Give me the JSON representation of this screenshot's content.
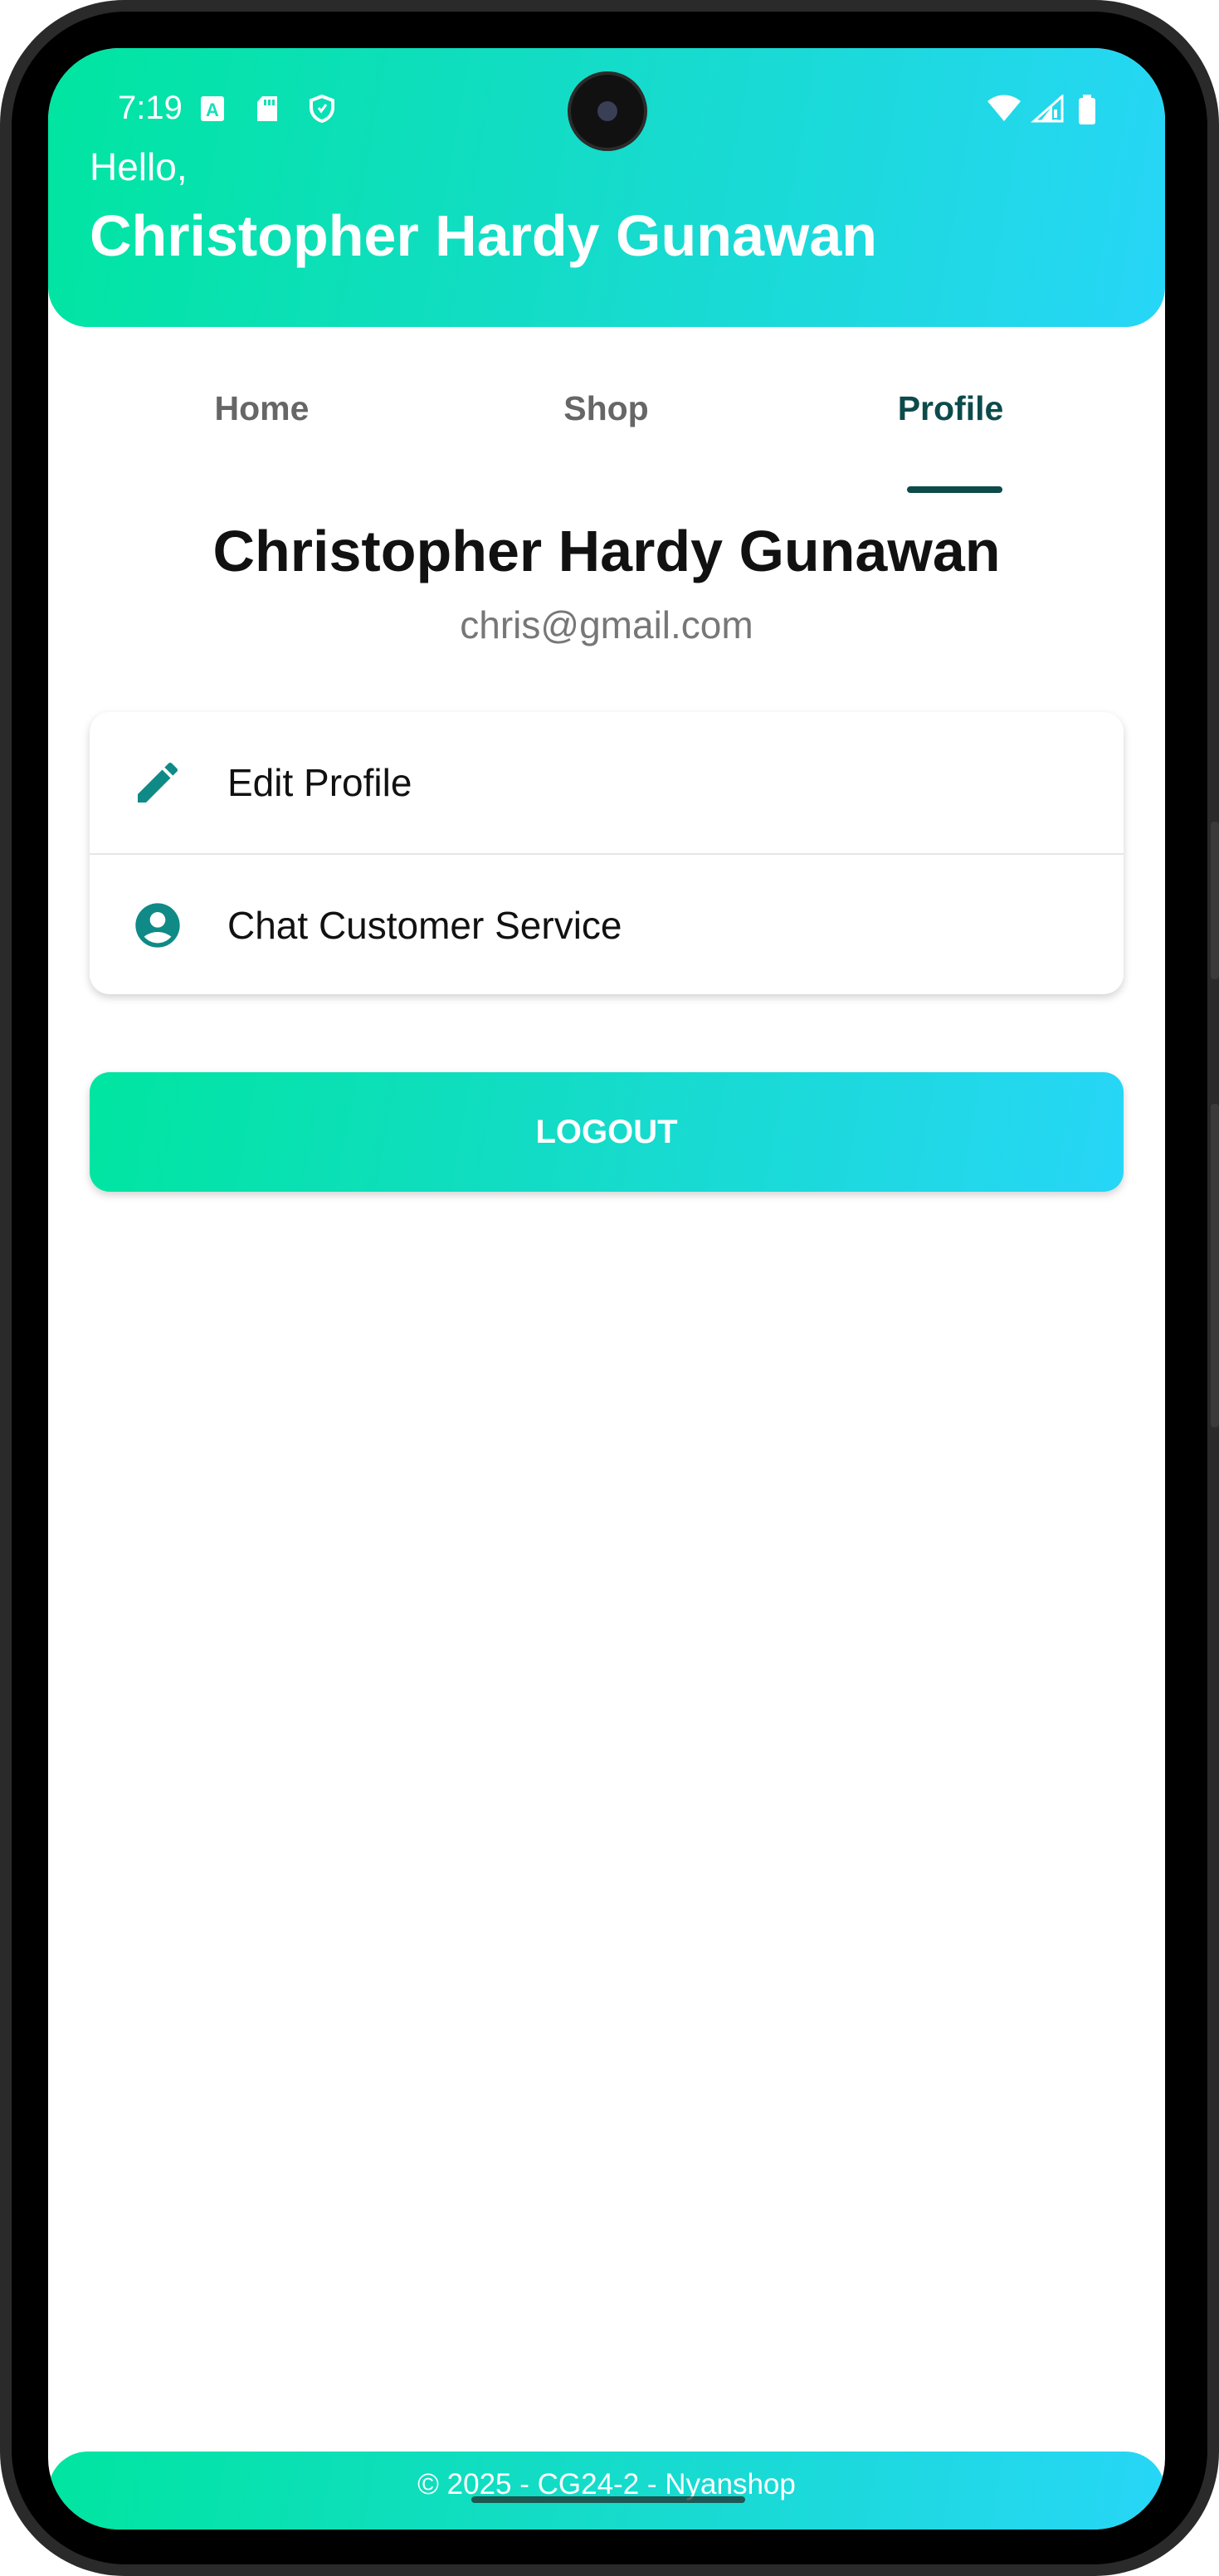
{
  "status_bar": {
    "time": "7:19",
    "left_icons": [
      "a-box-icon",
      "sd-card-icon",
      "shield-icon"
    ],
    "right_icons": [
      "wifi-icon",
      "signal-icon",
      "battery-icon"
    ]
  },
  "header": {
    "greeting": "Hello,",
    "name": "Christopher Hardy Gunawan"
  },
  "tabs": [
    {
      "label": "Home",
      "active": false
    },
    {
      "label": "Shop",
      "active": false
    },
    {
      "label": "Profile",
      "active": true
    }
  ],
  "profile": {
    "name": "Christopher Hardy Gunawan",
    "email": "chris@gmail.com"
  },
  "menu": [
    {
      "label": "Edit Profile",
      "icon": "pencil-icon"
    },
    {
      "label": "Chat Customer Service",
      "icon": "account-circle-icon"
    }
  ],
  "logout_label": "LOGOUT",
  "footer": {
    "text": "© 2025 - CG24-2 - Nyanshop"
  },
  "colors": {
    "gradient_start": "#00e5a0",
    "gradient_end": "#27d6f7",
    "accent": "#0d4b4b",
    "icon_teal": "#0f8a86"
  }
}
